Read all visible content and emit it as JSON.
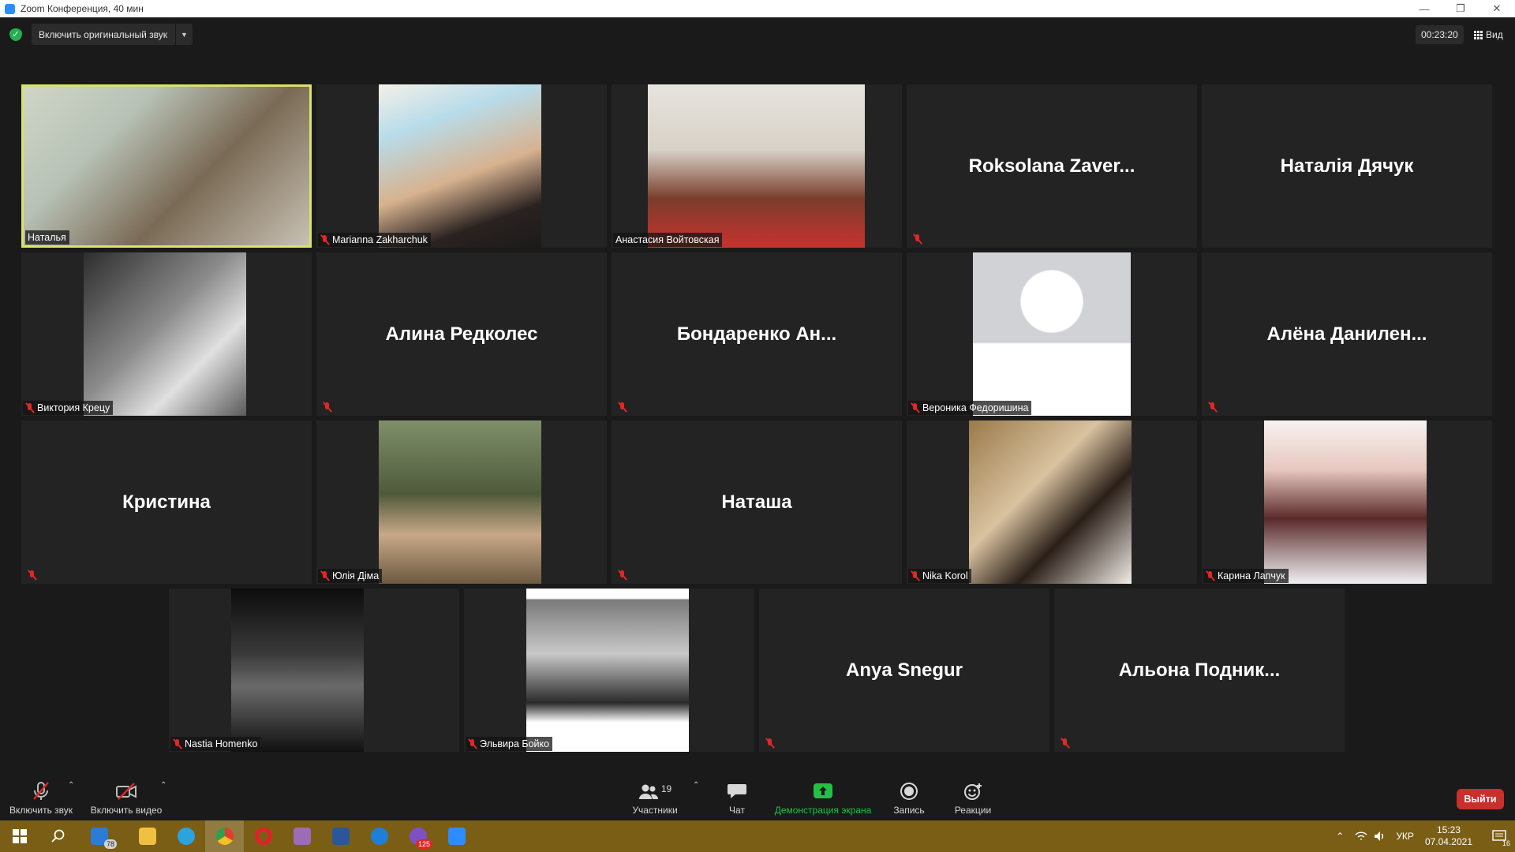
{
  "window": {
    "title": "Zoom Конференция, 40 мин"
  },
  "topbar": {
    "original_audio_label": "Включить оригинальный звук",
    "timer": "00:23:20",
    "view_label": "Вид"
  },
  "colors": {
    "active_speaker_border": "#d9e26a",
    "muted_icon": "#e02828",
    "leave_button": "#c9302c",
    "share_icon": "#23c043",
    "taskbar": "#7a5e16"
  },
  "participants": [
    {
      "name": "Наталья",
      "video": true,
      "muted": false,
      "active": true
    },
    {
      "name": "Marianna Zakharchuk",
      "video": true,
      "muted": true
    },
    {
      "name": "Анастасия Войтовская",
      "video": true,
      "muted": false
    },
    {
      "name": "Roksolana  Zaver...",
      "video": false,
      "muted": true
    },
    {
      "name": "Наталія Дячук",
      "video": false,
      "muted": false
    },
    {
      "name": "Виктория Крецу",
      "video": true,
      "muted": true
    },
    {
      "name": "Алина Редколес",
      "video": false,
      "muted": true
    },
    {
      "name": "Бондаренко  Ан...",
      "video": false,
      "muted": true
    },
    {
      "name": "Вероника Федоришина",
      "video": true,
      "muted": true
    },
    {
      "name": "Алёна  Данилен...",
      "video": false,
      "muted": true
    },
    {
      "name": "Кристина",
      "video": false,
      "muted": true
    },
    {
      "name": "Юлія Діма",
      "video": true,
      "muted": true
    },
    {
      "name": "Наташа",
      "video": false,
      "muted": true
    },
    {
      "name": "Nika Korol",
      "video": true,
      "muted": true
    },
    {
      "name": "Карина Лапчук",
      "video": true,
      "muted": true
    },
    {
      "name": "Nastia Homenko",
      "video": true,
      "muted": true
    },
    {
      "name": "Эльвира Бойко",
      "video": true,
      "muted": true
    },
    {
      "name": "Anya Snegur",
      "video": false,
      "muted": true
    },
    {
      "name": "Альона  Подник...",
      "video": false,
      "muted": true
    }
  ],
  "toolbar": {
    "unmute_label": "Включить звук",
    "start_video_label": "Включить видео",
    "participants_label": "Участники",
    "participants_count": "19",
    "chat_label": "Чат",
    "share_label": "Демонстрация экрана",
    "record_label": "Запись",
    "reactions_label": "Реакции",
    "leave_label": "Выйти"
  },
  "taskbar": {
    "mail_badge": "78",
    "viber_badge": "125",
    "language": "УКР",
    "time": "15:23",
    "date": "07.04.2021",
    "notifications": "16",
    "apps": [
      "windows-start-icon",
      "search-icon",
      "mail-icon",
      "folder-icon",
      "telegram-icon",
      "chrome-icon",
      "opera-icon",
      "archive-icon",
      "word-icon",
      "edge-icon",
      "viber-icon",
      "zoom-icon"
    ]
  }
}
